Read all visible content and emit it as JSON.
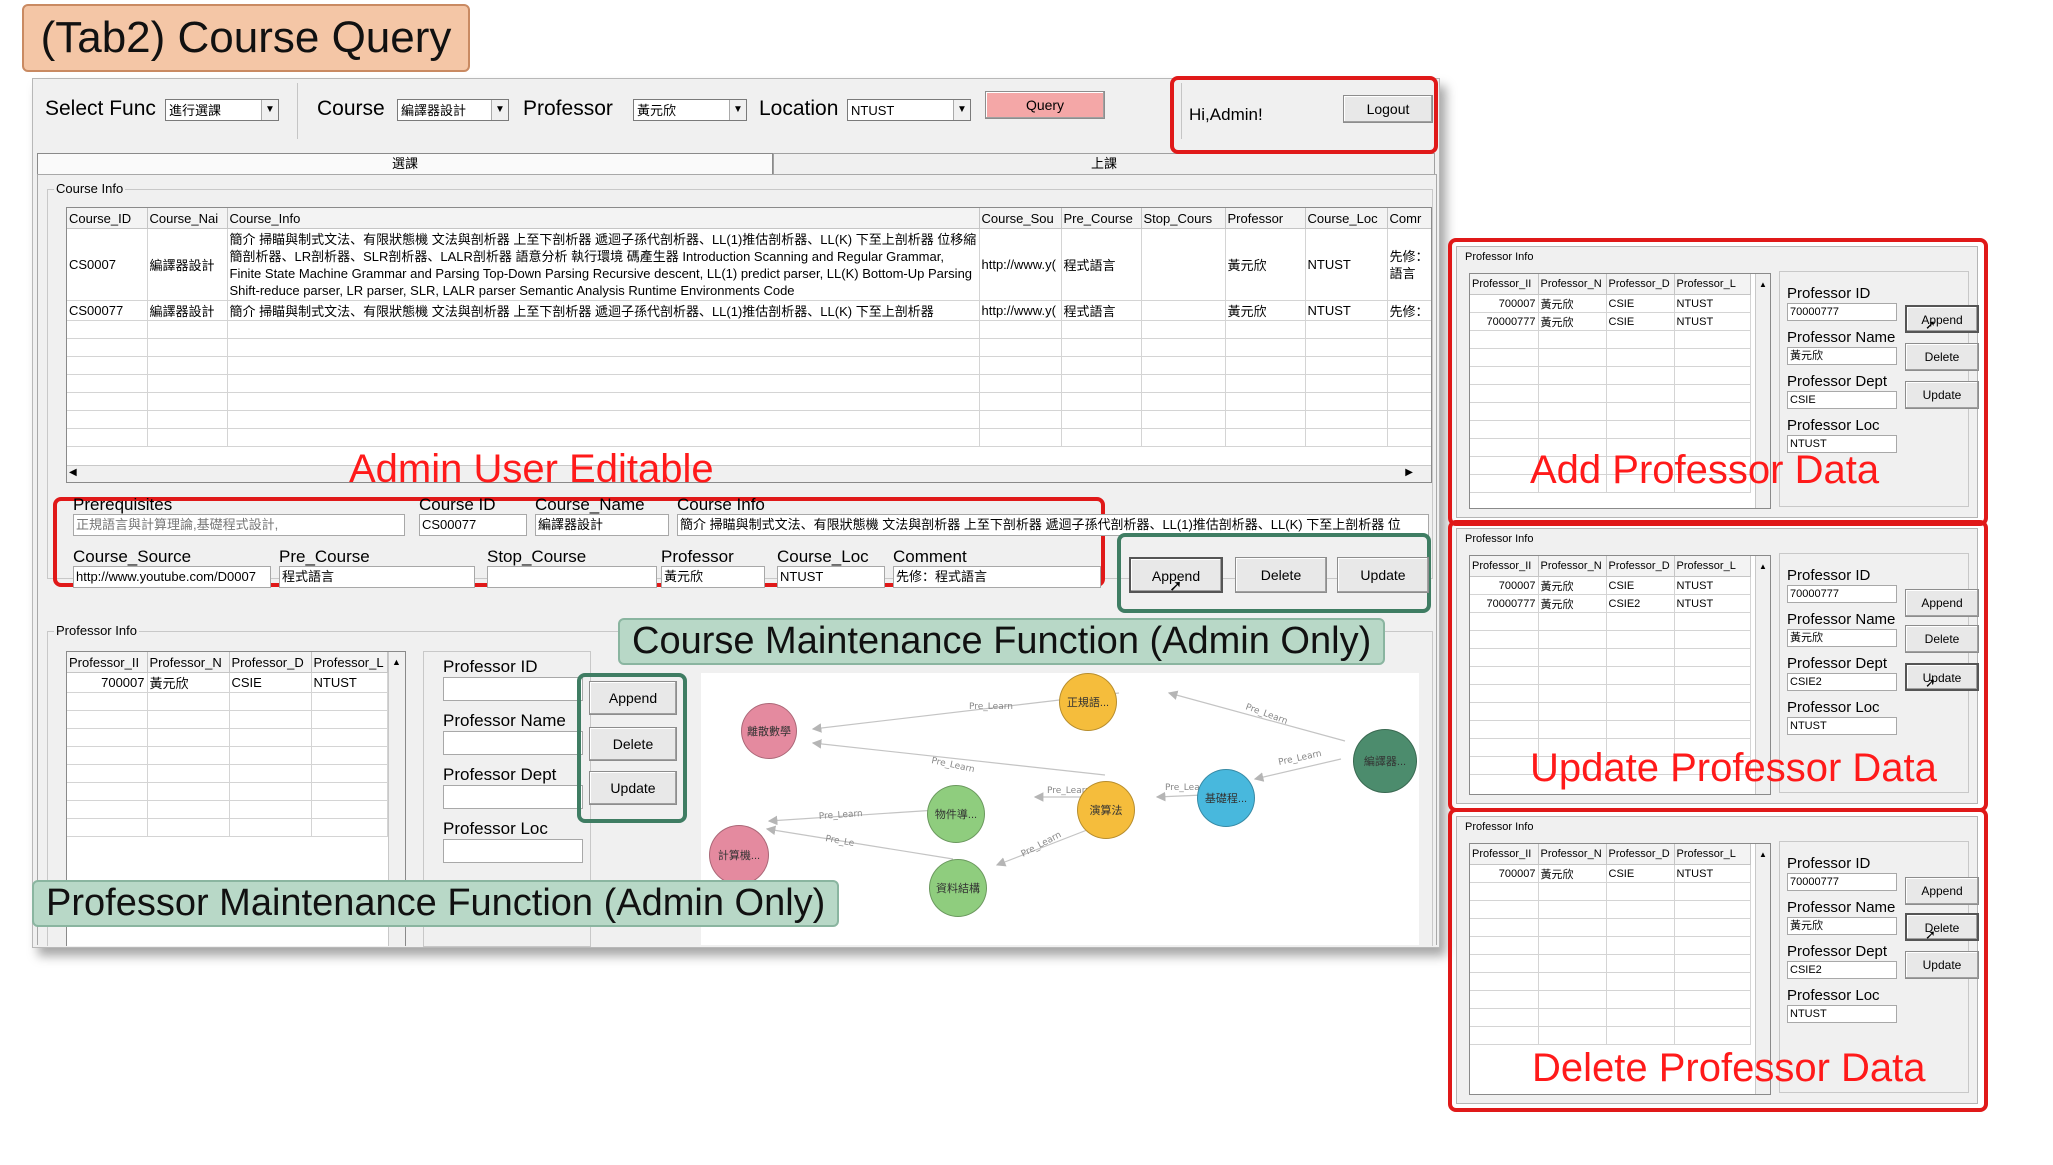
{
  "title_badge": "(Tab2) Course Query",
  "toolbar": {
    "select_func_label": "Select Func",
    "select_func_value": "進行選課",
    "course_label": "Course",
    "course_value": "編譯器設計",
    "professor_label": "Professor",
    "professor_value": "黃元欣",
    "location_label": "Location",
    "location_value": "NTUST",
    "query_button": "Query",
    "greeting": "Hi,Admin!",
    "logout_button": "Logout"
  },
  "tabs": [
    "選課",
    "上課"
  ],
  "course_info": {
    "group_title": "Course Info",
    "columns": [
      "Course_ID",
      "Course_Nai",
      "Course_Info",
      "Course_Sou",
      "Pre_Course",
      "Stop_Cours",
      "Professor",
      "Course_Loc",
      "Comr"
    ],
    "rows": [
      {
        "id": "CS0007",
        "name": "編譯器設計",
        "info": "簡介 掃瞄與制式文法、有限狀態機 文法與剖析器 上至下剖析器 遞迴子孫代剖析器、LL(1)推估剖析器、LL(K) 下至上剖析器 位移縮簡剖析器、LR剖析器、SLR剖析器、LALR剖析器 語意分析 執行環境 碼產生器 Introduction Scanning and Regular Grammar, Finite State Machine Grammar and Parsing Top-Down Parsing Recursive descent, LL(1) predict parser, LL(K) Bottom-Up Parsing Shift-reduce parser, LR parser, SLR, LALR parser Semantic Analysis Runtime Environments Code",
        "source": "http://www.y(",
        "pre": "程式語言",
        "stop": "",
        "professor": "黃元欣",
        "loc": "NTUST",
        "comment": "先修：語言"
      },
      {
        "id": "CS00077",
        "name": "編譯器設計",
        "info": "簡介 掃瞄與制式文法、有限狀態機 文法與剖析器 上至下剖析器 遞迴子孫代剖析器、LL(1)推估剖析器、LL(K) 下至上剖析器",
        "source": "http://www.y(",
        "pre": "程式語言",
        "stop": "",
        "professor": "黃元欣",
        "loc": "NTUST",
        "comment": "先修："
      }
    ]
  },
  "admin_editable_label": "Admin User Editable",
  "edit_fields": {
    "prerequisites_label": "Prerequisites",
    "prerequisites_value": "正規語言與計算理論,基礎程式設計,",
    "course_id_label": "Course ID",
    "course_id_value": "CS00077",
    "course_name_label": "Course_Name",
    "course_name_value": "編譯器設計",
    "course_info_label": "Course Info",
    "course_info_value": "簡介 掃瞄與制式文法、有限狀態機 文法與剖析器 上至下剖析器 遞迴子孫代剖析器、LL(1)推估剖析器、LL(K) 下至上剖析器 位",
    "course_source_label": "Course_Source",
    "course_source_value": "http://www.youtube.com/D0007",
    "pre_course_label": "Pre_Course",
    "pre_course_value": "程式語言",
    "stop_course_label": "Stop_Course",
    "stop_course_value": "",
    "professor_label": "Professor",
    "professor_value": "黃元欣",
    "course_loc_label": "Course_Loc",
    "course_loc_value": "NTUST",
    "comment_label": "Comment",
    "comment_value": "先修：程式語言"
  },
  "course_buttons": {
    "append": "Append",
    "delete": "Delete",
    "update": "Update"
  },
  "course_maintenance_label": "Course Maintenance Function (Admin Only)",
  "professor_info": {
    "group_title": "Professor Info",
    "columns": [
      "Professor_II",
      "Professor_N",
      "Professor_D",
      "Professor_L"
    ],
    "rows": [
      {
        "id": "700007",
        "name": "黃元欣",
        "dept": "CSIE",
        "loc": "NTUST"
      }
    ],
    "id_label": "Professor ID",
    "name_label": "Professor Name",
    "dept_label": "Professor Dept",
    "loc_label": "Professor Loc",
    "append": "Append",
    "delete": "Delete",
    "update": "Update"
  },
  "professor_maintenance_label": "Professor Maintenance Function (Admin Only)",
  "graph": {
    "nodes": [
      {
        "label": "離散數學",
        "color": "#e48a9f"
      },
      {
        "label": "正規語...",
        "color": "#f5bd3c"
      },
      {
        "label": "編譯器...",
        "color": "#4c8c6d"
      },
      {
        "label": "物件導...",
        "color": "#8fcd7e"
      },
      {
        "label": "演算法",
        "color": "#f5bd3c"
      },
      {
        "label": "基礎程...",
        "color": "#48b8dd"
      },
      {
        "label": "計算機...",
        "color": "#e48a9f"
      },
      {
        "label": "資料結構",
        "color": "#8fcd7e"
      }
    ],
    "edge_label": "Pre_Learn"
  },
  "side_panels": [
    {
      "caption": "Add Professor Data",
      "group_title": "Professor Info",
      "columns": [
        "Professor_II",
        "Professor_N",
        "Professor_D",
        "Professor_L"
      ],
      "rows": [
        {
          "id": "700007",
          "name": "黃元欣",
          "dept": "CSIE",
          "loc": "NTUST"
        },
        {
          "id": "70000777",
          "name": "黃元欣",
          "dept": "CSIE",
          "loc": "NTUST"
        }
      ],
      "id_label": "Professor ID",
      "id_value": "70000777",
      "name_label": "Professor Name",
      "name_value": "黃元欣",
      "dept_label": "Professor Dept",
      "dept_value": "CSIE",
      "loc_label": "Professor Loc",
      "loc_value": "NTUST",
      "append": "Append",
      "delete": "Delete",
      "update": "Update"
    },
    {
      "caption": "Update Professor Data",
      "group_title": "Professor Info",
      "columns": [
        "Professor_II",
        "Professor_N",
        "Professor_D",
        "Professor_L"
      ],
      "rows": [
        {
          "id": "700007",
          "name": "黃元欣",
          "dept": "CSIE",
          "loc": "NTUST"
        },
        {
          "id": "70000777",
          "name": "黃元欣",
          "dept": "CSIE2",
          "loc": "NTUST"
        }
      ],
      "id_label": "Professor ID",
      "id_value": "70000777",
      "name_label": "Professor Name",
      "name_value": "黃元欣",
      "dept_label": "Professor Dept",
      "dept_value": "CSIE2",
      "loc_label": "Professor Loc",
      "loc_value": "NTUST",
      "append": "Append",
      "delete": "Delete",
      "update": "Update"
    },
    {
      "caption": "Delete Professor Data",
      "group_title": "Professor Info",
      "columns": [
        "Professor_II",
        "Professor_N",
        "Professor_D",
        "Professor_L"
      ],
      "rows": [
        {
          "id": "700007",
          "name": "黃元欣",
          "dept": "CSIE",
          "loc": "NTUST"
        }
      ],
      "id_label": "Professor ID",
      "id_value": "70000777",
      "name_label": "Professor Name",
      "name_value": "黃元欣",
      "dept_label": "Professor Dept",
      "dept_value": "CSIE2",
      "loc_label": "Professor Loc",
      "loc_value": "NTUST",
      "append": "Append",
      "delete": "Delete",
      "update": "Update"
    }
  ]
}
